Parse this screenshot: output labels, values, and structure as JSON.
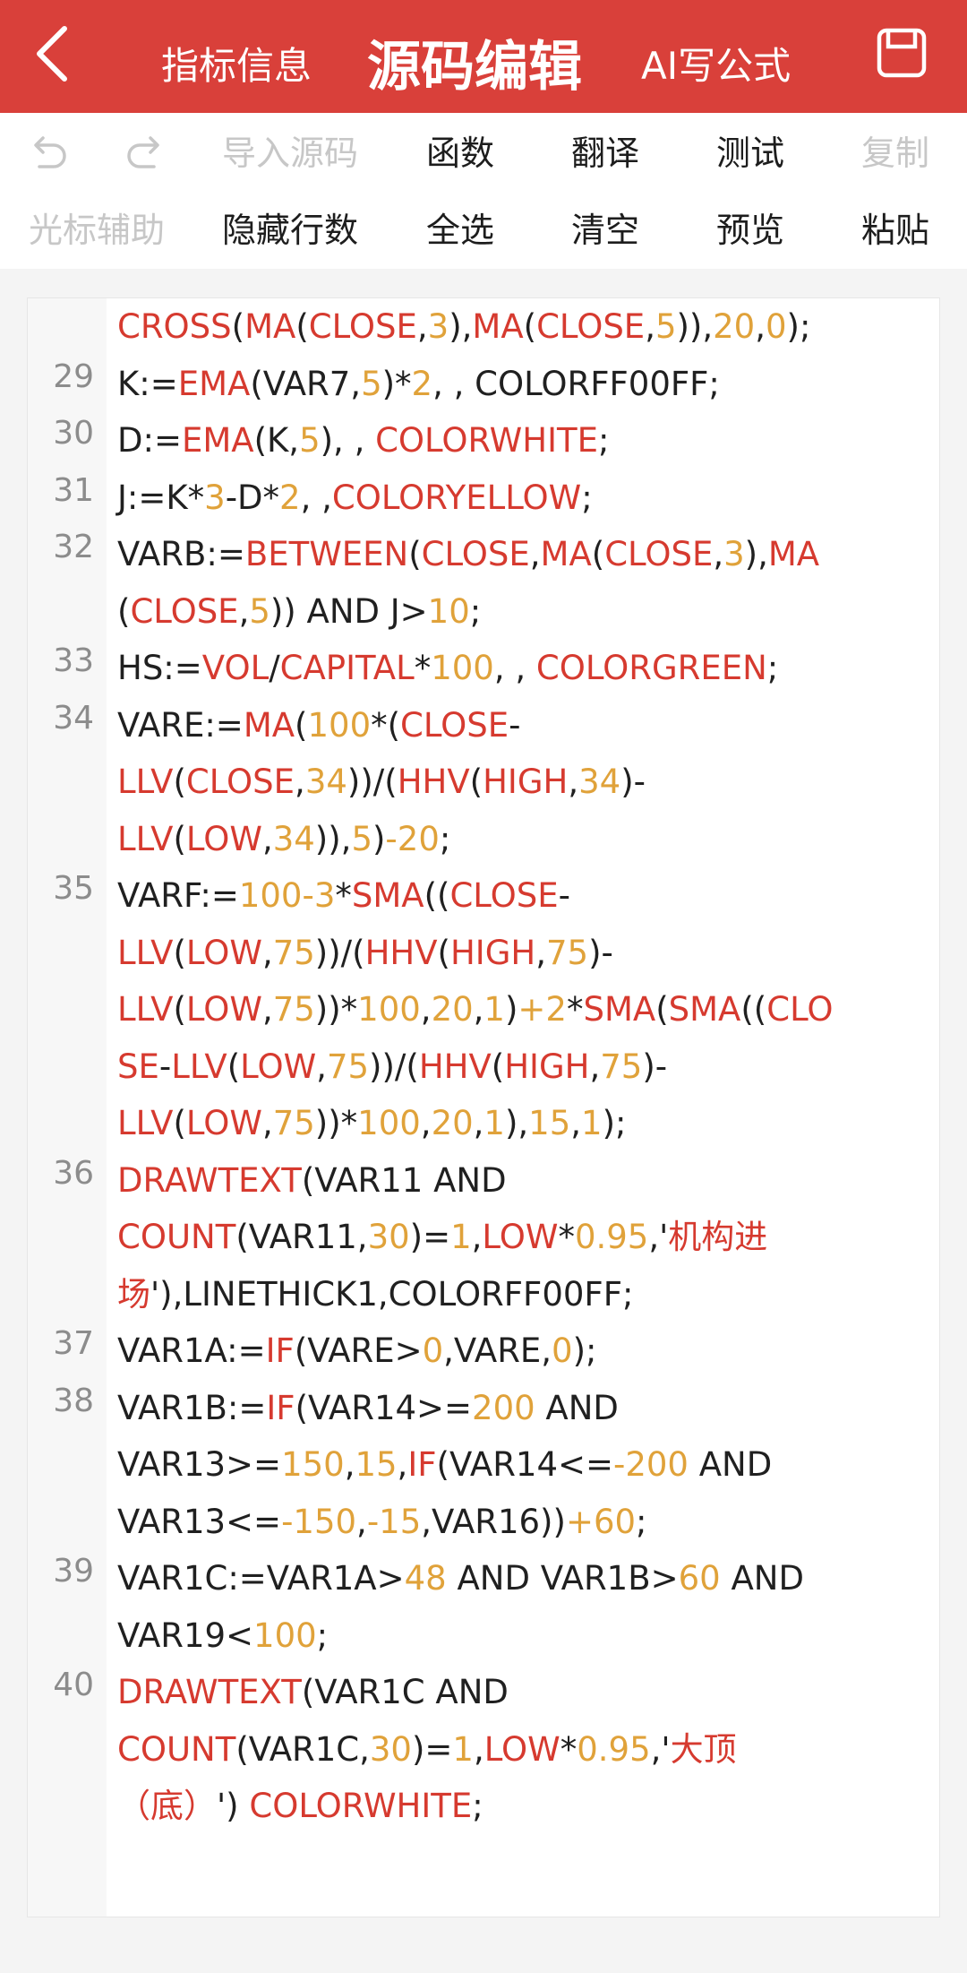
{
  "header": {
    "back_icon": "chevron-left-icon",
    "tabs": [
      "指标信息",
      "源码编辑",
      "AI写公式"
    ],
    "active_tab": "源码编辑",
    "save_icon": "save-icon",
    "color": "#d9403a"
  },
  "toolbar": {
    "row1": {
      "undo_icon": "undo-icon",
      "redo_icon": "redo-icon",
      "import_label": "导入源码",
      "functions_label": "函数",
      "translate_label": "翻译",
      "test_label": "测试",
      "copy_label": "复制"
    },
    "row2": {
      "cursor_assist_label": "光标辅助",
      "hide_line_numbers_label": "隐藏行数",
      "select_all_label": "全选",
      "clear_label": "清空",
      "preview_label": "预览",
      "paste_label": "粘贴"
    }
  },
  "colors": {
    "keyword": "#d63a2f",
    "number": "#e0a23a",
    "text": "#202020"
  },
  "editor": {
    "lines": [
      {
        "num": "",
        "code": [
          [
            "k",
            "CROSS"
          ],
          [
            "t",
            "("
          ],
          [
            "k",
            "MA"
          ],
          [
            "t",
            "("
          ],
          [
            "k",
            "CLOSE"
          ],
          [
            "t",
            ","
          ],
          [
            "n",
            "3"
          ],
          [
            "t",
            "),"
          ],
          [
            "k",
            "MA"
          ],
          [
            "t",
            "("
          ],
          [
            "k",
            "CLOSE"
          ],
          [
            "t",
            ","
          ],
          [
            "n",
            "5"
          ],
          [
            "t",
            "))"
          ],
          [
            "t",
            ","
          ],
          [
            "n",
            "20"
          ],
          [
            "t",
            ","
          ],
          [
            "n",
            "0"
          ],
          [
            "t",
            ");"
          ]
        ]
      },
      {
        "num": "29",
        "code": [
          [
            "t",
            "K:="
          ],
          [
            "k",
            "EMA"
          ],
          [
            "t",
            "(VAR7,"
          ],
          [
            "n",
            "5"
          ],
          [
            "t",
            ")*"
          ],
          [
            "n",
            "2"
          ],
          [
            "t",
            ", , COLORFF00FF;"
          ]
        ]
      },
      {
        "num": "30",
        "code": [
          [
            "t",
            "D:="
          ],
          [
            "k",
            "EMA"
          ],
          [
            "t",
            "(K,"
          ],
          [
            "n",
            "5"
          ],
          [
            "t",
            "), , "
          ],
          [
            "k",
            "COLORWHITE"
          ],
          [
            "t",
            ";"
          ]
        ]
      },
      {
        "num": "31",
        "code": [
          [
            "t",
            "J:=K*"
          ],
          [
            "n",
            "3"
          ],
          [
            "t",
            "-D*"
          ],
          [
            "n",
            "2"
          ],
          [
            "t",
            ", ,"
          ],
          [
            "k",
            "COLORYELLOW"
          ],
          [
            "t",
            ";"
          ]
        ]
      },
      {
        "num": "32",
        "code": [
          [
            "t",
            "VARB:="
          ],
          [
            "k",
            "BETWEEN"
          ],
          [
            "t",
            "("
          ],
          [
            "k",
            "CLOSE"
          ],
          [
            "t",
            ","
          ],
          [
            "k",
            "MA"
          ],
          [
            "t",
            "("
          ],
          [
            "k",
            "CLOSE"
          ],
          [
            "t",
            ","
          ],
          [
            "n",
            "3"
          ],
          [
            "t",
            "),"
          ],
          [
            "k",
            "MA"
          ],
          [
            "t",
            "\n("
          ],
          [
            "k",
            "CLOSE"
          ],
          [
            "t",
            ","
          ],
          [
            "n",
            "5"
          ],
          [
            "t",
            ")) AND J>"
          ],
          [
            "n",
            "10"
          ],
          [
            "t",
            ";"
          ]
        ]
      },
      {
        "num": "33",
        "code": [
          [
            "t",
            "HS:="
          ],
          [
            "k",
            "VOL"
          ],
          [
            "t",
            "/"
          ],
          [
            "k",
            "CAPITAL"
          ],
          [
            "t",
            "*"
          ],
          [
            "n",
            "100"
          ],
          [
            "t",
            ", , "
          ],
          [
            "k",
            "COLORGREEN"
          ],
          [
            "t",
            ";"
          ]
        ]
      },
      {
        "num": "34",
        "code": [
          [
            "t",
            "VARE:="
          ],
          [
            "k",
            "MA"
          ],
          [
            "t",
            "("
          ],
          [
            "n",
            "100"
          ],
          [
            "t",
            "*("
          ],
          [
            "k",
            "CLOSE"
          ],
          [
            "t",
            "-\n"
          ],
          [
            "k",
            "LLV"
          ],
          [
            "t",
            "("
          ],
          [
            "k",
            "CLOSE"
          ],
          [
            "t",
            ","
          ],
          [
            "n",
            "34"
          ],
          [
            "t",
            "))/("
          ],
          [
            "k",
            "HHV"
          ],
          [
            "t",
            "("
          ],
          [
            "k",
            "HIGH"
          ],
          [
            "t",
            ","
          ],
          [
            "n",
            "34"
          ],
          [
            "t",
            ")-\n"
          ],
          [
            "k",
            "LLV"
          ],
          [
            "t",
            "("
          ],
          [
            "k",
            "LOW"
          ],
          [
            "t",
            ","
          ],
          [
            "n",
            "34"
          ],
          [
            "t",
            ")),"
          ],
          [
            "n",
            "5"
          ],
          [
            "t",
            ")"
          ],
          [
            "n",
            "-20"
          ],
          [
            "t",
            ";"
          ]
        ]
      },
      {
        "num": "35",
        "code": [
          [
            "t",
            "VARF:="
          ],
          [
            "n",
            "100-3"
          ],
          [
            "t",
            "*"
          ],
          [
            "k",
            "SMA"
          ],
          [
            "t",
            "(("
          ],
          [
            "k",
            "CLOSE"
          ],
          [
            "t",
            "-\n"
          ],
          [
            "k",
            "LLV"
          ],
          [
            "t",
            "("
          ],
          [
            "k",
            "LOW"
          ],
          [
            "t",
            ","
          ],
          [
            "n",
            "75"
          ],
          [
            "t",
            "))/("
          ],
          [
            "k",
            "HHV"
          ],
          [
            "t",
            "("
          ],
          [
            "k",
            "HIGH"
          ],
          [
            "t",
            ","
          ],
          [
            "n",
            "75"
          ],
          [
            "t",
            ")-\n"
          ],
          [
            "k",
            "LLV"
          ],
          [
            "t",
            "("
          ],
          [
            "k",
            "LOW"
          ],
          [
            "t",
            ","
          ],
          [
            "n",
            "75"
          ],
          [
            "t",
            "))*"
          ],
          [
            "n",
            "100"
          ],
          [
            "t",
            ","
          ],
          [
            "n",
            "20"
          ],
          [
            "t",
            ","
          ],
          [
            "n",
            "1"
          ],
          [
            "t",
            ")"
          ],
          [
            "n",
            "+2"
          ],
          [
            "t",
            "*"
          ],
          [
            "k",
            "SMA"
          ],
          [
            "t",
            "("
          ],
          [
            "k",
            "SMA"
          ],
          [
            "t",
            "(("
          ],
          [
            "k",
            "CLO\nSE"
          ],
          [
            "t",
            "-"
          ],
          [
            "k",
            "LLV"
          ],
          [
            "t",
            "("
          ],
          [
            "k",
            "LOW"
          ],
          [
            "t",
            ","
          ],
          [
            "n",
            "75"
          ],
          [
            "t",
            "))/("
          ],
          [
            "k",
            "HHV"
          ],
          [
            "t",
            "("
          ],
          [
            "k",
            "HIGH"
          ],
          [
            "t",
            ","
          ],
          [
            "n",
            "75"
          ],
          [
            "t",
            ")-\n"
          ],
          [
            "k",
            "LLV"
          ],
          [
            "t",
            "("
          ],
          [
            "k",
            "LOW"
          ],
          [
            "t",
            ","
          ],
          [
            "n",
            "75"
          ],
          [
            "t",
            "))*"
          ],
          [
            "n",
            "100"
          ],
          [
            "t",
            ","
          ],
          [
            "n",
            "20"
          ],
          [
            "t",
            ","
          ],
          [
            "n",
            "1"
          ],
          [
            "t",
            "),"
          ],
          [
            "n",
            "15"
          ],
          [
            "t",
            ","
          ],
          [
            "n",
            "1"
          ],
          [
            "t",
            ");"
          ]
        ]
      },
      {
        "num": "36",
        "code": [
          [
            "k",
            "DRAWTEXT"
          ],
          [
            "t",
            "(VAR11 AND\n"
          ],
          [
            "k",
            "COUNT"
          ],
          [
            "t",
            "(VAR11,"
          ],
          [
            "n",
            "30"
          ],
          [
            "t",
            ")="
          ],
          [
            "n",
            "1"
          ],
          [
            "t",
            ","
          ],
          [
            "k",
            "LOW"
          ],
          [
            "t",
            "*"
          ],
          [
            "n",
            "0.95"
          ],
          [
            "t",
            ",'"
          ],
          [
            "k",
            "机构进\n场"
          ],
          [
            "t",
            "'),LINETHICK1,COLORFF00FF;"
          ]
        ]
      },
      {
        "num": "37",
        "code": [
          [
            "t",
            "VAR1A:="
          ],
          [
            "k",
            "IF"
          ],
          [
            "t",
            "(VARE>"
          ],
          [
            "n",
            "0"
          ],
          [
            "t",
            ",VARE,"
          ],
          [
            "n",
            "0"
          ],
          [
            "t",
            ");"
          ]
        ]
      },
      {
        "num": "38",
        "code": [
          [
            "t",
            "VAR1B:="
          ],
          [
            "k",
            "IF"
          ],
          [
            "t",
            "(VAR14>="
          ],
          [
            "n",
            "200"
          ],
          [
            "t",
            " AND\nVAR13>="
          ],
          [
            "n",
            "150"
          ],
          [
            "t",
            ","
          ],
          [
            "n",
            "15"
          ],
          [
            "t",
            ","
          ],
          [
            "k",
            "IF"
          ],
          [
            "t",
            "(VAR14<="
          ],
          [
            "n",
            "-200"
          ],
          [
            "t",
            " AND\nVAR13<="
          ],
          [
            "n",
            "-150"
          ],
          [
            "t",
            ","
          ],
          [
            "n",
            "-15"
          ],
          [
            "t",
            ",VAR16))"
          ],
          [
            "n",
            "+60"
          ],
          [
            "t",
            ";"
          ]
        ]
      },
      {
        "num": "39",
        "code": [
          [
            "t",
            "VAR1C:=VAR1A>"
          ],
          [
            "n",
            "48"
          ],
          [
            "t",
            " AND VAR1B>"
          ],
          [
            "n",
            "60"
          ],
          [
            "t",
            " AND\nVAR19<"
          ],
          [
            "n",
            "100"
          ],
          [
            "t",
            ";"
          ]
        ]
      },
      {
        "num": "40",
        "code": [
          [
            "k",
            "DRAWTEXT"
          ],
          [
            "t",
            "(VAR1C AND\n"
          ],
          [
            "k",
            "COUNT"
          ],
          [
            "t",
            "(VAR1C,"
          ],
          [
            "n",
            "30"
          ],
          [
            "t",
            ")="
          ],
          [
            "n",
            "1"
          ],
          [
            "t",
            ","
          ],
          [
            "k",
            "LOW"
          ],
          [
            "t",
            "*"
          ],
          [
            "n",
            "0.95"
          ],
          [
            "t",
            ",'"
          ],
          [
            "k",
            "大顶\n（底）"
          ],
          [
            "t",
            "') "
          ],
          [
            "k",
            "COLORWHITE"
          ],
          [
            "t",
            ";"
          ]
        ]
      }
    ]
  }
}
